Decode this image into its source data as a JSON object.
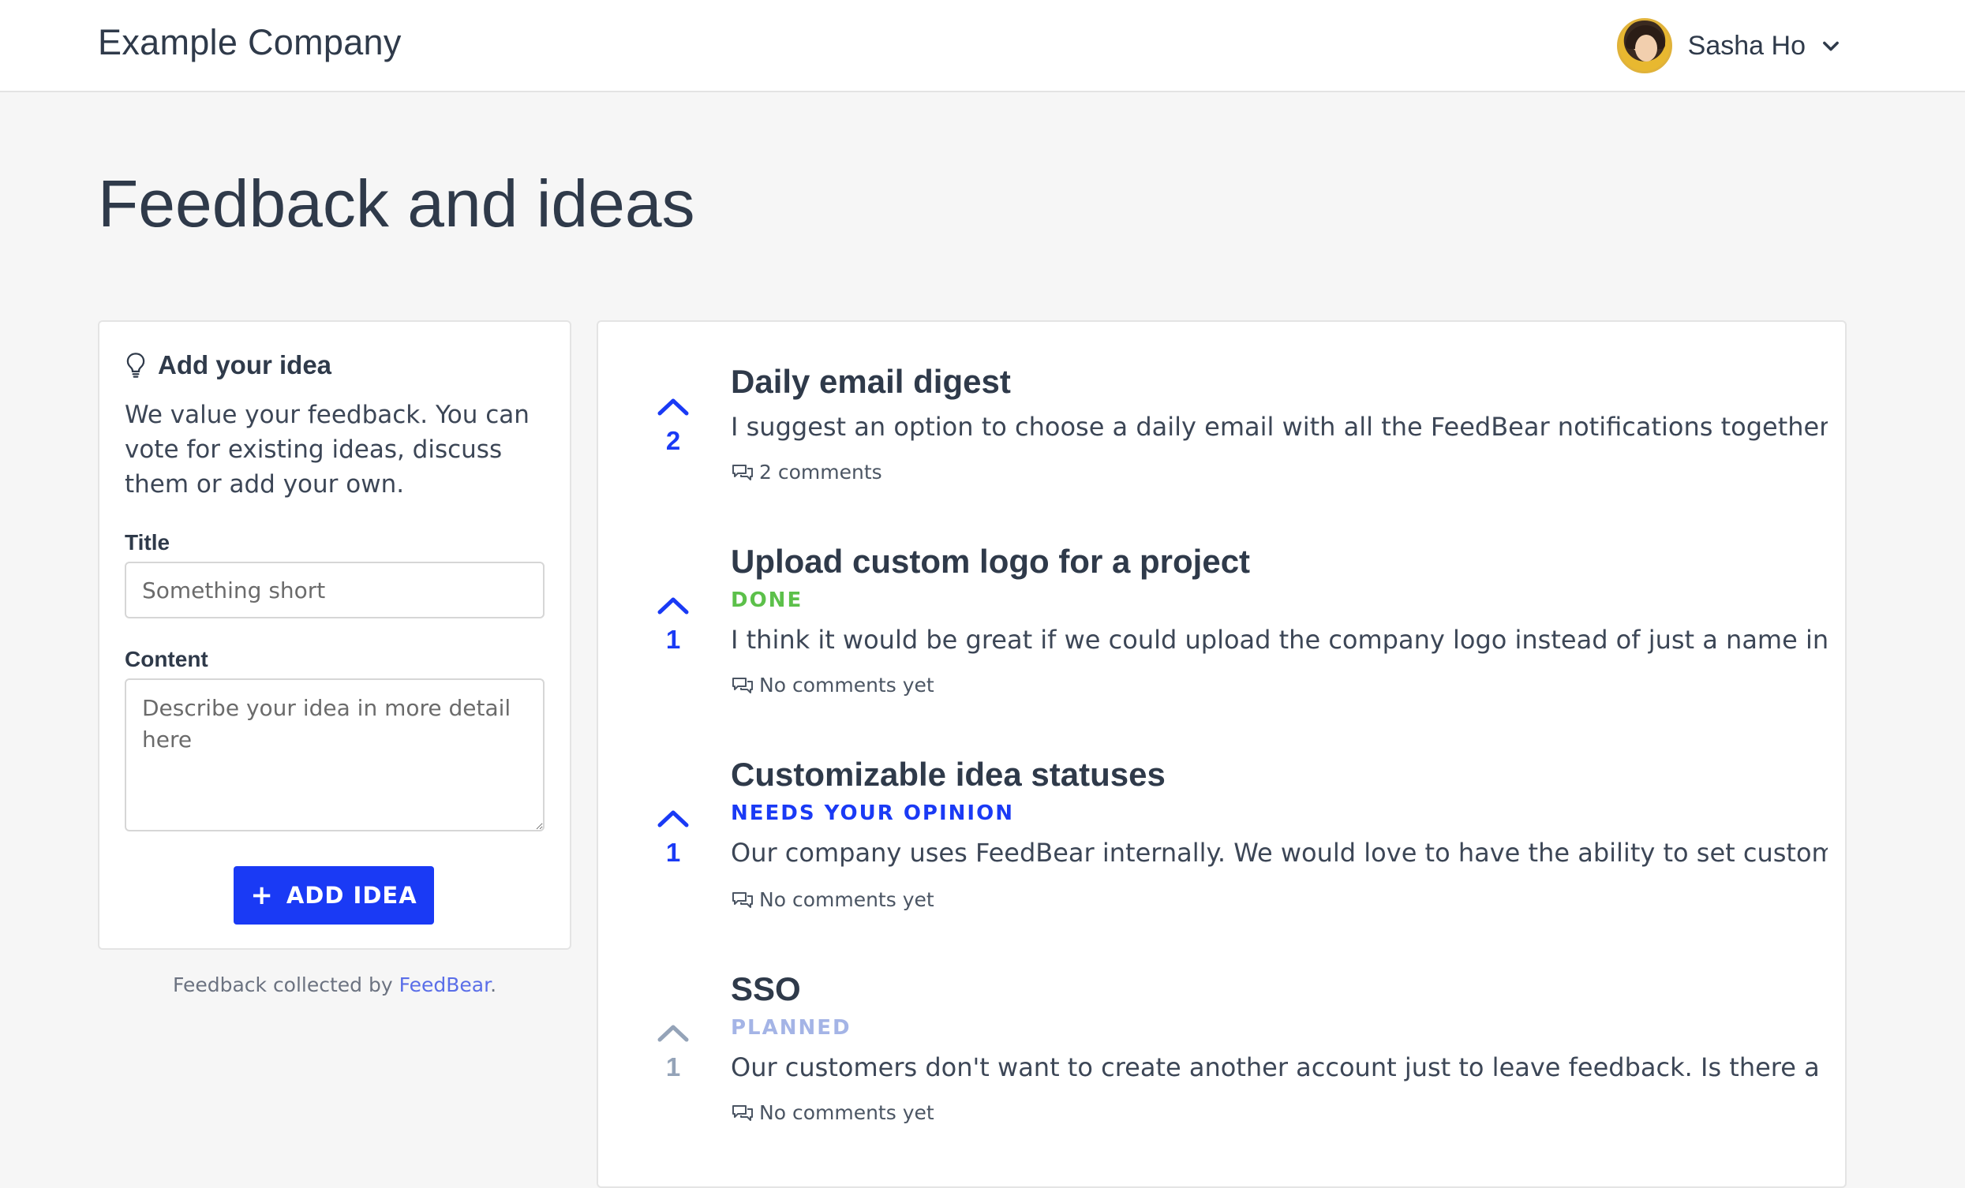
{
  "header": {
    "company": "Example Company",
    "user_name": "Sasha Ho"
  },
  "page": {
    "title": "Feedback and ideas"
  },
  "form": {
    "heading": "Add your idea",
    "intro": "We value your feedback. You can vote for existing ideas, discuss them or add your own.",
    "title_label": "Title",
    "title_placeholder": "Something short",
    "content_label": "Content",
    "content_placeholder": "Describe your idea in more detail here",
    "button_label": "ADD IDEA"
  },
  "credit": {
    "prefix": "Feedback collected by ",
    "link": "FeedBear",
    "suffix": "."
  },
  "colors": {
    "accent": "#1a3af5",
    "done": "#5cc04a",
    "needs_opinion": "#1a3af5",
    "planned": "#a4b4e6"
  },
  "ideas": [
    {
      "title": "Daily email digest",
      "votes": "2",
      "status": "",
      "description": "I suggest an option to choose a daily email with all the FeedBear notifications together....",
      "comments": "2 comments"
    },
    {
      "title": "Upload custom logo for a project",
      "votes": "1",
      "status": "DONE",
      "description": "I think it would be great if we could upload the company logo instead of just a name in...",
      "comments": "No comments yet"
    },
    {
      "title": "Customizable idea statuses",
      "votes": "1",
      "status": "NEEDS YOUR OPINION",
      "description": "Our company uses FeedBear internally. We would love to have the ability to set custom...",
      "comments": "No comments yet"
    },
    {
      "title": "SSO",
      "votes": "1",
      "status": "PLANNED",
      "description": "Our customers don't want to create another account just to leave feedback. Is there a wa...",
      "comments": "No comments yet"
    }
  ]
}
